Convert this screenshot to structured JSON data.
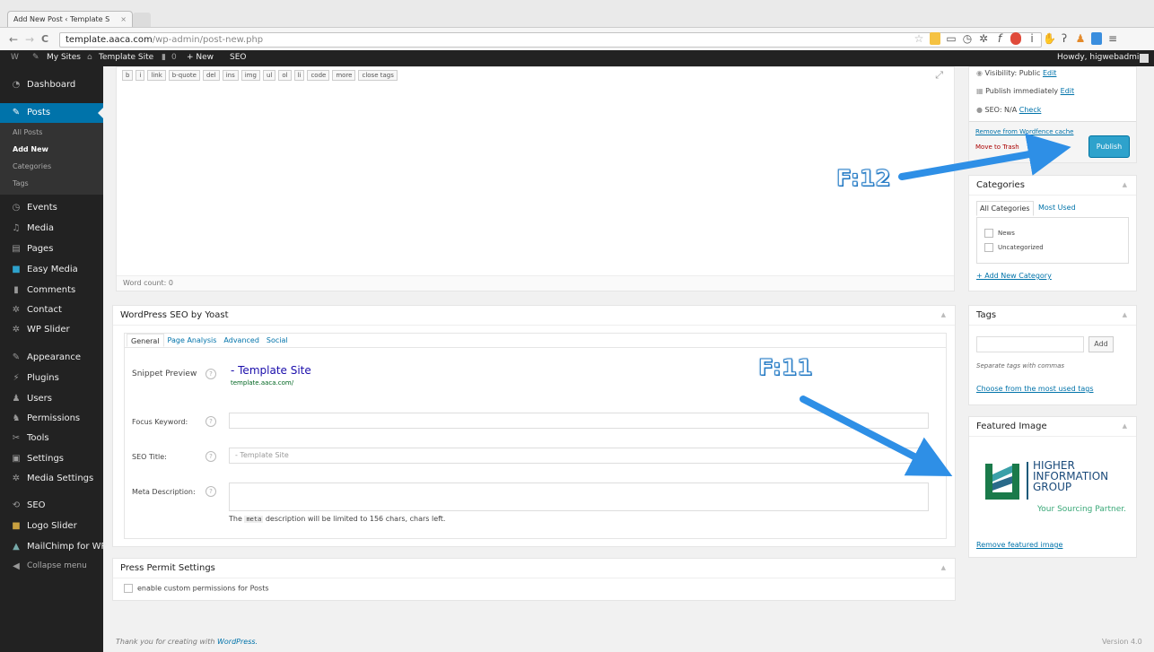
{
  "browser": {
    "tab_title": "Add New Post ‹ Template S",
    "tab_close": "×",
    "url_host": "template.aaca.com",
    "url_path": "/wp-admin/post-new.php",
    "back": "←",
    "forward": "→",
    "reload": "C"
  },
  "adminbar": {
    "wp": "W",
    "my_sites": "My Sites",
    "site_name": "Template Site",
    "comments": "0",
    "new": "+ New",
    "seo": "SEO",
    "howdy": "Howdy, higwebadmin"
  },
  "menu": {
    "dashboard": "Dashboard",
    "posts": "Posts",
    "events": "Events",
    "media": "Media",
    "pages": "Pages",
    "easy_media": "Easy Media",
    "comments": "Comments",
    "contact": "Contact",
    "wp_slider": "WP Slider",
    "appearance": "Appearance",
    "plugins": "Plugins",
    "users": "Users",
    "permissions": "Permissions",
    "tools": "Tools",
    "settings": "Settings",
    "media_settings": "Media Settings",
    "seo": "SEO",
    "logo_slider": "Logo Slider",
    "mailchimp": "MailChimp for WP",
    "collapse": "Collapse menu"
  },
  "submenu": {
    "all_posts": "All Posts",
    "add_new": "Add New",
    "categories": "Categories",
    "tags": "Tags"
  },
  "editor": {
    "buttons": [
      "b",
      "i",
      "link",
      "b-quote",
      "del",
      "ins",
      "img",
      "ul",
      "ol",
      "li",
      "code",
      "more",
      "close tags"
    ],
    "word_count": "Word count: 0",
    "fullscreen": "⤢"
  },
  "seo_box": {
    "title": "WordPress SEO by Yoast",
    "tabs": [
      "General",
      "Page Analysis",
      "Advanced",
      "Social"
    ],
    "snippet_label": "Snippet Preview",
    "snippet_title": "- Template Site",
    "snippet_url": "template.aaca.com/",
    "focus_label": "Focus Keyword:",
    "seo_title_label": "SEO Title:",
    "seo_title_placeholder": "- Template Site",
    "meta_label": "Meta Description:",
    "meta_note_pre": "The",
    "meta_note_code": "meta",
    "meta_note_post": "description will be limited to 156 chars, chars left.",
    "help": "?"
  },
  "press_box": {
    "title": "Press Permit Settings",
    "checkbox_label": "enable custom permissions for Posts"
  },
  "publish_box": {
    "visibility": "Visibility: Public",
    "visibility_edit": "Edit",
    "publish_immediately": "Publish immediately",
    "publish_edit": "Edit",
    "seo": "SEO: N/A",
    "seo_check": "Check",
    "remove_cache": "Remove from Wordfence cache",
    "trash": "Move to Trash",
    "publish_btn": "Publish"
  },
  "categories_box": {
    "title": "Categories",
    "tab_all": "All Categories",
    "tab_most": "Most Used",
    "items": [
      "News",
      "Uncategorized"
    ],
    "add_new": "+ Add New Category"
  },
  "tags_box": {
    "title": "Tags",
    "add_btn": "Add",
    "hint": "Separate tags with commas",
    "choose": "Choose from the most used tags"
  },
  "featured_box": {
    "title": "Featured Image",
    "logo_line1": "HIGHER",
    "logo_line2": "INFORMATION",
    "logo_line3": "GROUP",
    "logo_tagline": "Your Sourcing Partner.",
    "remove": "Remove featured image"
  },
  "footer": {
    "thanks_pre": "Thank you for creating with",
    "thanks_link": "WordPress.",
    "version": "Version 4.0"
  },
  "callouts": {
    "f12": "F:12",
    "f11": "F:11"
  },
  "colors": {
    "wp_blue": "#0073aa",
    "arrow_blue": "#2e8fe6",
    "admin_dark": "#222222"
  }
}
